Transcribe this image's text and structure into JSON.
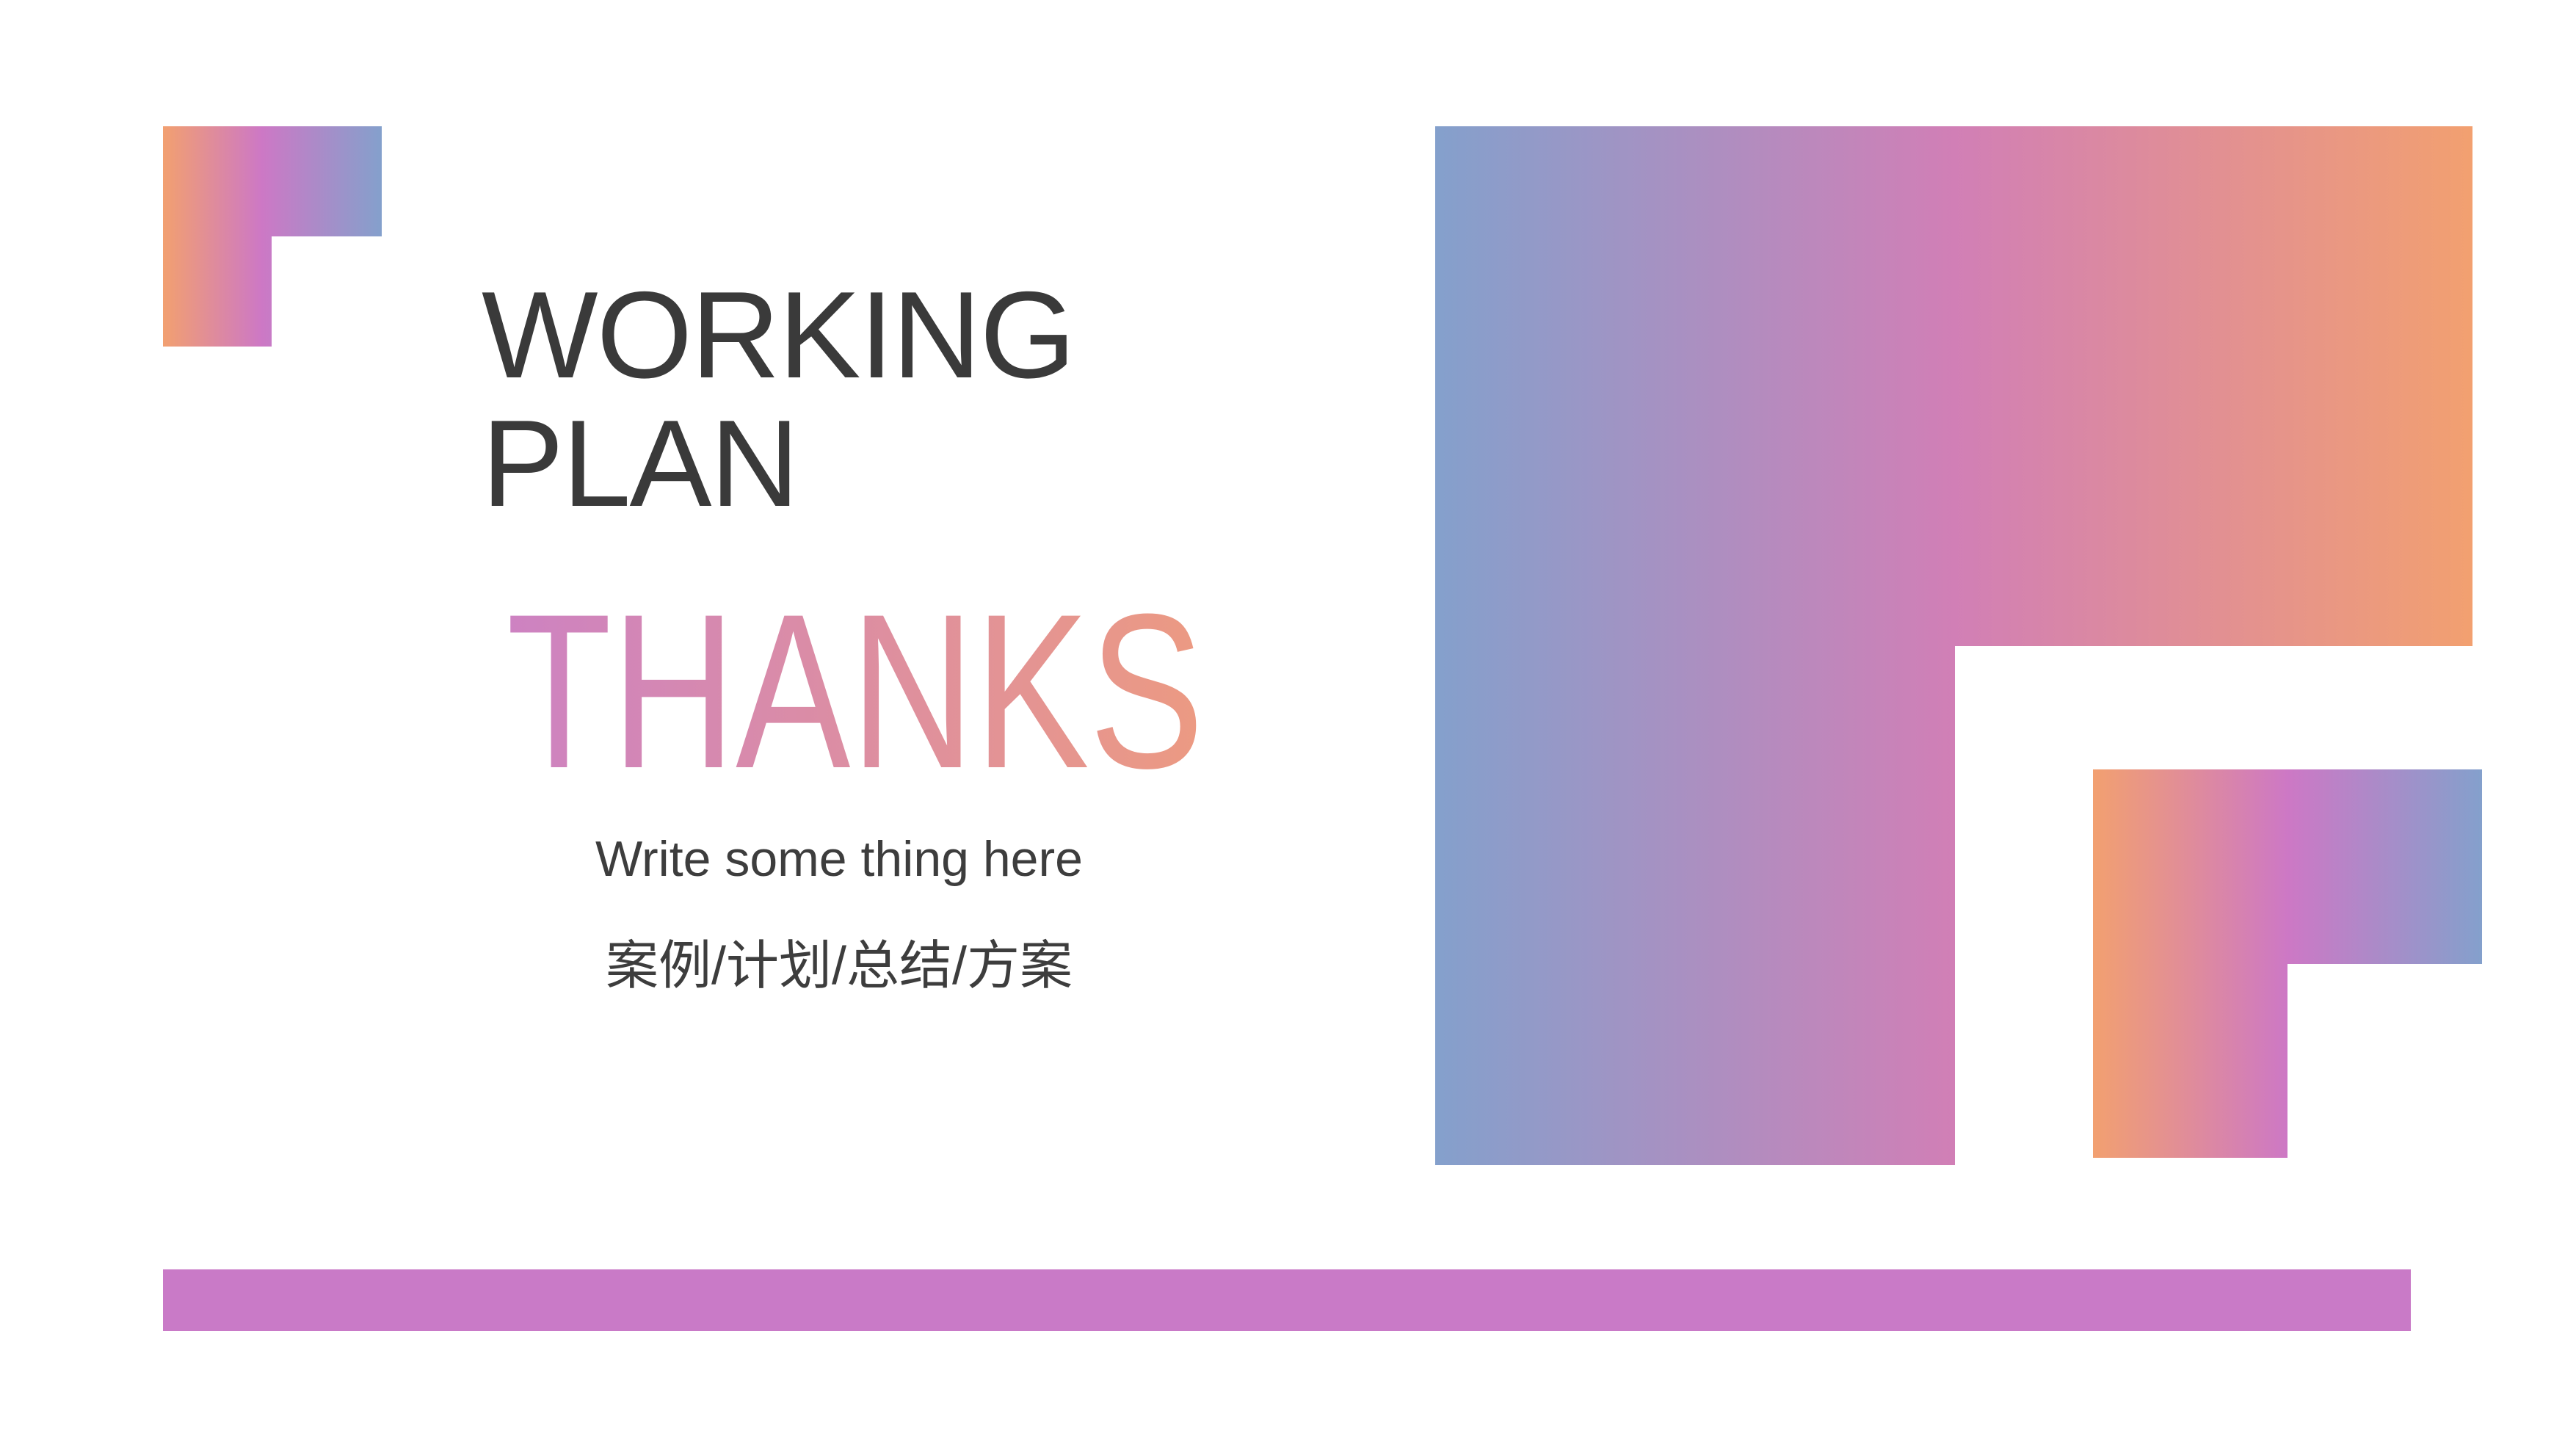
{
  "slide": {
    "title_lines": [
      "WORKING",
      "PLAN"
    ],
    "thanks_text": "THANKS",
    "subtitle_en": "Write some thing here",
    "subtitle_cn": "案例/计划/总结/方案"
  },
  "colors": {
    "blue": "#84a0cc",
    "pink": "#cd78c5",
    "orange": "#f2a070",
    "bar": "#c97ac7",
    "text": "#3a3a3a"
  }
}
